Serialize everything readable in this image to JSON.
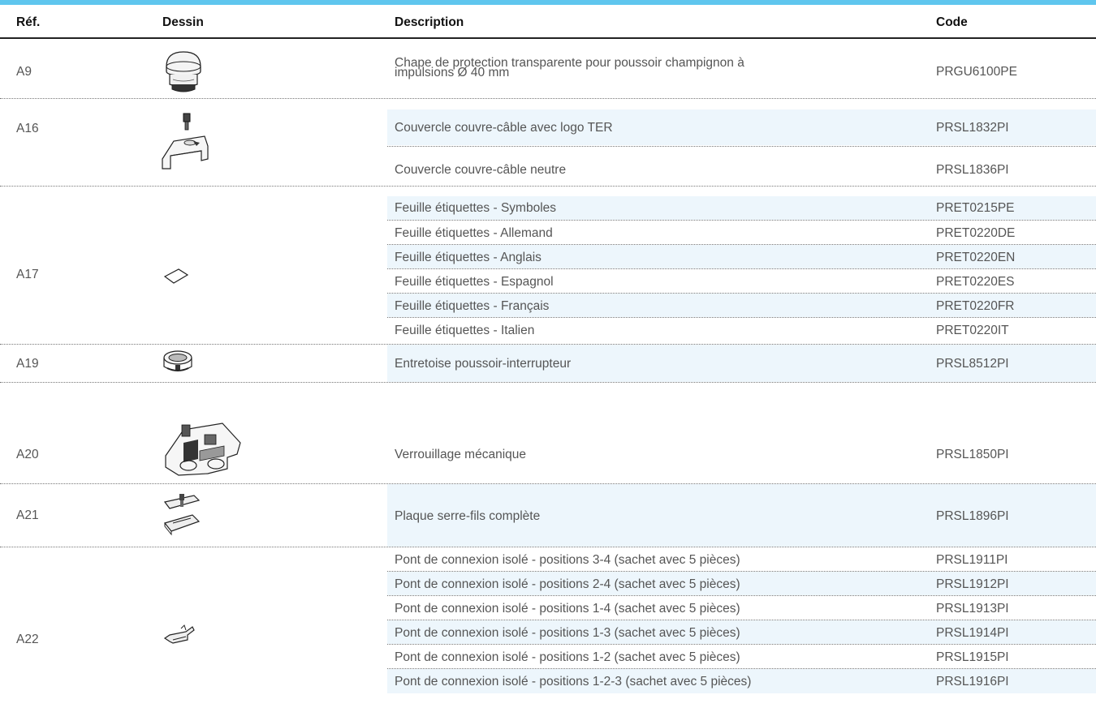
{
  "colors": {
    "accent_bar": "#5fc6ee",
    "alt_row": "#edf6fc"
  },
  "header": {
    "ref": "Réf.",
    "drawing": "Dessin",
    "description": "Description",
    "code": "Code"
  },
  "groups": [
    {
      "ref": "A9",
      "drawing_icon": "mushroom-cap-icon",
      "items": [
        {
          "description": "Chape de protection transparente pour poussoir champignon à\nimpulsions Ø 40 mm",
          "code": "PRGU6100PE"
        }
      ]
    },
    {
      "ref": "A16",
      "drawing_icon": "cable-cover-icon",
      "items": [
        {
          "description": "Couvercle couvre-câble avec logo TER",
          "code": "PRSL1832PI"
        },
        {
          "description": "Couvercle couvre-câble neutre",
          "code": "PRSL1836PI"
        }
      ]
    },
    {
      "ref": "A17",
      "drawing_icon": "label-sheet-icon",
      "items": [
        {
          "description": "Feuille étiquettes - Symboles",
          "code": "PRET0215PE"
        },
        {
          "description": "Feuille étiquettes - Allemand",
          "code": "PRET0220DE"
        },
        {
          "description": "Feuille étiquettes - Anglais",
          "code": "PRET0220EN"
        },
        {
          "description": "Feuille étiquettes - Espagnol",
          "code": "PRET0220ES"
        },
        {
          "description": "Feuille étiquettes - Français",
          "code": "PRET0220FR"
        },
        {
          "description": "Feuille étiquettes - Italien",
          "code": "PRET0220IT"
        }
      ]
    },
    {
      "ref": "A19",
      "drawing_icon": "spacer-ring-icon",
      "items": [
        {
          "description": "Entretoise poussoir-interrupteur",
          "code": "PRSL8512PI"
        }
      ]
    },
    {
      "ref": "A20",
      "drawing_icon": "mechanical-lock-icon",
      "items": [
        {
          "description": "Verrouillage mécanique",
          "code": "PRSL1850PI"
        }
      ]
    },
    {
      "ref": "A21",
      "drawing_icon": "wire-clamp-plate-icon",
      "items": [
        {
          "description": "Plaque serre-fils complète",
          "code": "PRSL1896PI"
        }
      ]
    },
    {
      "ref": "A22",
      "drawing_icon": "connection-bridge-icon",
      "items": [
        {
          "description": "Pont de connexion isolé - positions 3-4 (sachet avec 5 pièces)",
          "code": "PRSL1911PI"
        },
        {
          "description": "Pont de connexion isolé - positions 2-4 (sachet avec 5 pièces)",
          "code": "PRSL1912PI"
        },
        {
          "description": "Pont de connexion isolé - positions 1-4 (sachet avec 5 pièces)",
          "code": "PRSL1913PI"
        },
        {
          "description": "Pont de connexion isolé - positions 1-3 (sachet avec 5 pièces)",
          "code": "PRSL1914PI"
        },
        {
          "description": "Pont de connexion isolé - positions 1-2 (sachet avec 5 pièces)",
          "code": "PRSL1915PI"
        },
        {
          "description": "Pont de connexion isolé - positions 1-2-3 (sachet avec 5 pièces)",
          "code": "PRSL1916PI"
        }
      ]
    }
  ]
}
